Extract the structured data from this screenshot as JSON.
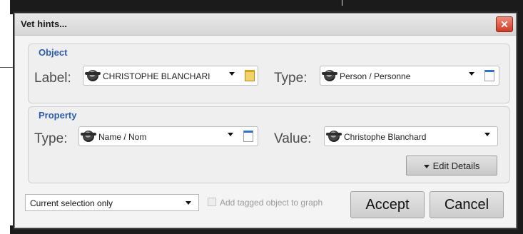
{
  "window": {
    "title": "Vet hints...",
    "close_label": "✕"
  },
  "object": {
    "legend": "Object",
    "label_label": "Label:",
    "label_value": "CHRISTOPHE BLANCHARI",
    "type_label": "Type:",
    "type_value": "Person / Personne"
  },
  "property": {
    "legend": "Property",
    "type_label": "Type:",
    "type_value": "Name / Nom",
    "value_label": "Value:",
    "value_value": "Christophe Blanchard",
    "edit_details_label": "Edit Details"
  },
  "footer": {
    "scope_value": "Current selection only",
    "add_tagged_label": "Add tagged object to graph",
    "add_tagged_checked": false,
    "accept_label": "Accept",
    "cancel_label": "Cancel"
  },
  "colors": {
    "legend": "#2a5db0",
    "close": "#d23a25"
  },
  "icons": [
    "person-icon",
    "note-icon",
    "dropdown-caret-icon",
    "close-icon"
  ]
}
